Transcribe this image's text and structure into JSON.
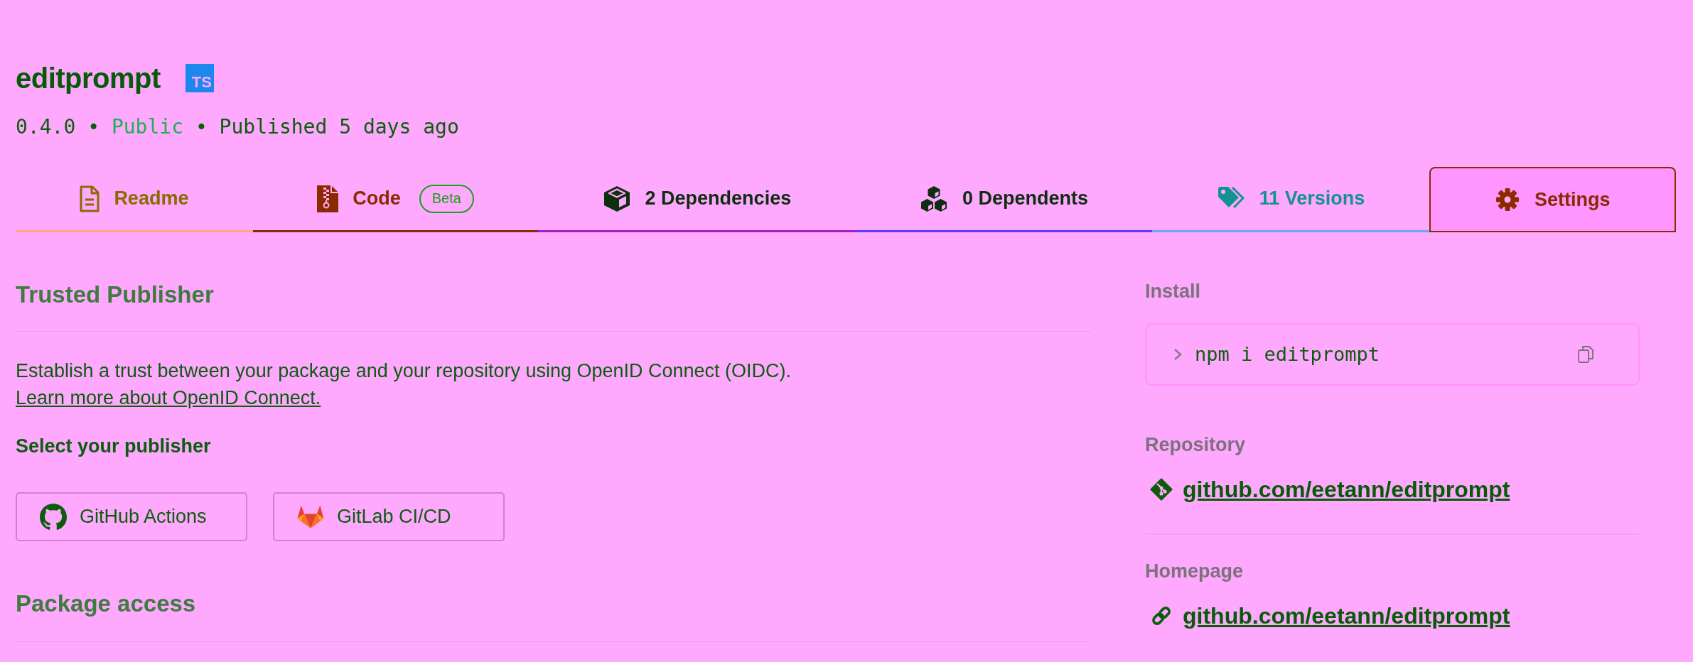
{
  "package": {
    "name": "editprompt",
    "types_badge": "TS",
    "meta": [
      {
        "kind": "version",
        "text": "0.4.0"
      },
      {
        "kind": "separator",
        "text": "•"
      },
      {
        "kind": "visibility",
        "text": "Public"
      },
      {
        "kind": "separator",
        "text": "•"
      },
      {
        "kind": "published",
        "text": "Published 5 days ago"
      }
    ]
  },
  "tabs": [
    {
      "kind": "readme",
      "label": "Readme",
      "selected": false
    },
    {
      "kind": "code",
      "label": "Code",
      "badge": "Beta",
      "selected": false
    },
    {
      "kind": "dependencies",
      "label": "2 Dependencies",
      "selected": false
    },
    {
      "kind": "dependents",
      "label": "0 Dependents",
      "selected": false
    },
    {
      "kind": "versions",
      "label": "11 Versions",
      "selected": false
    },
    {
      "kind": "settings",
      "label": "Settings",
      "selected": true
    }
  ],
  "trusted_publisher": {
    "title": "Trusted Publisher",
    "description": "Establish a trust between your package and your repository using OpenID Connect (OIDC).",
    "link": "Learn more about OpenID Connect.",
    "prompt": "Select your publisher",
    "publishers": [
      {
        "kind": "github",
        "label": "GitHub Actions"
      },
      {
        "kind": "gitlab",
        "label": "GitLab CI/CD"
      }
    ]
  },
  "package_access": {
    "title": "Package access"
  },
  "sidebar": {
    "install": {
      "label": "Install",
      "command": "npm i editprompt"
    },
    "repository": {
      "label": "Repository",
      "link": "github.com/eetann/editprompt"
    },
    "homepage": {
      "label": "Homepage",
      "link": "github.com/eetann/editprompt"
    }
  }
}
